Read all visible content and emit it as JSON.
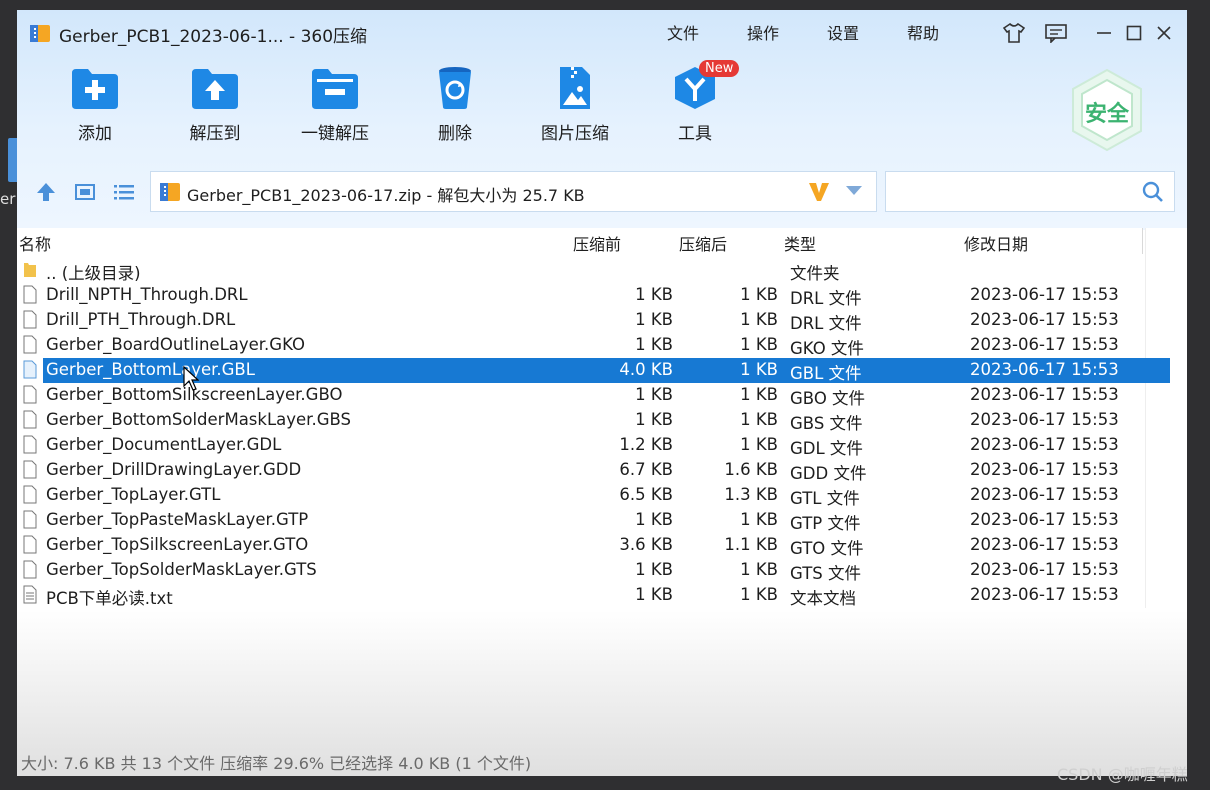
{
  "desktop": {
    "partial_label": "er"
  },
  "window": {
    "title": "Gerber_PCB1_2023-06-1... - 360压缩",
    "menu": [
      "文件",
      "操作",
      "设置",
      "帮助"
    ]
  },
  "toolbar": {
    "buttons": [
      "添加",
      "解压到",
      "一键解压",
      "删除",
      "图片压缩",
      "工具"
    ],
    "new_badge": "New",
    "safety_badge": "安全"
  },
  "address": {
    "text": "Gerber_PCB1_2023-06-17.zip - 解包大小为 25.7 KB",
    "search_placeholder": ""
  },
  "columns": [
    "名称",
    "压缩前",
    "压缩后",
    "类型",
    "修改日期"
  ],
  "rows": [
    {
      "name": ".. (上级目录)",
      "before": "",
      "after": "",
      "type": "文件夹",
      "date": ""
    },
    {
      "name": "Drill_NPTH_Through.DRL",
      "before": "1 KB",
      "after": "1 KB",
      "type": "DRL 文件",
      "date": "2023-06-17 15:53"
    },
    {
      "name": "Drill_PTH_Through.DRL",
      "before": "1 KB",
      "after": "1 KB",
      "type": "DRL 文件",
      "date": "2023-06-17 15:53"
    },
    {
      "name": "Gerber_BoardOutlineLayer.GKO",
      "before": "1 KB",
      "after": "1 KB",
      "type": "GKO 文件",
      "date": "2023-06-17 15:53"
    },
    {
      "name": "Gerber_BottomLayer.GBL",
      "before": "4.0 KB",
      "after": "1 KB",
      "type": "GBL 文件",
      "date": "2023-06-17 15:53"
    },
    {
      "name": "Gerber_BottomSilkscreenLayer.GBO",
      "before": "1 KB",
      "after": "1 KB",
      "type": "GBO 文件",
      "date": "2023-06-17 15:53"
    },
    {
      "name": "Gerber_BottomSolderMaskLayer.GBS",
      "before": "1 KB",
      "after": "1 KB",
      "type": "GBS 文件",
      "date": "2023-06-17 15:53"
    },
    {
      "name": "Gerber_DocumentLayer.GDL",
      "before": "1.2 KB",
      "after": "1 KB",
      "type": "GDL 文件",
      "date": "2023-06-17 15:53"
    },
    {
      "name": "Gerber_DrillDrawingLayer.GDD",
      "before": "6.7 KB",
      "after": "1.6 KB",
      "type": "GDD 文件",
      "date": "2023-06-17 15:53"
    },
    {
      "name": "Gerber_TopLayer.GTL",
      "before": "6.5 KB",
      "after": "1.3 KB",
      "type": "GTL 文件",
      "date": "2023-06-17 15:53"
    },
    {
      "name": "Gerber_TopPasteMaskLayer.GTP",
      "before": "1 KB",
      "after": "1 KB",
      "type": "GTP 文件",
      "date": "2023-06-17 15:53"
    },
    {
      "name": "Gerber_TopSilkscreenLayer.GTO",
      "before": "3.6 KB",
      "after": "1.1 KB",
      "type": "GTO 文件",
      "date": "2023-06-17 15:53"
    },
    {
      "name": "Gerber_TopSolderMaskLayer.GTS",
      "before": "1 KB",
      "after": "1 KB",
      "type": "GTS 文件",
      "date": "2023-06-17 15:53"
    },
    {
      "name": "PCB下单必读.txt",
      "before": "1 KB",
      "after": "1 KB",
      "type": "文本文档",
      "date": "2023-06-17 15:53"
    }
  ],
  "status": "大小: 7.6 KB 共 13 个文件 压缩率 29.6% 已经选择 4.0 KB (1 个文件)",
  "watermark": "CSDN @咖喱年糕",
  "colors": {
    "selection": "#1779d3",
    "toolbar_icon": "#1e88e5",
    "safe_badge": "#3cb371",
    "new_badge": "#e53935"
  }
}
